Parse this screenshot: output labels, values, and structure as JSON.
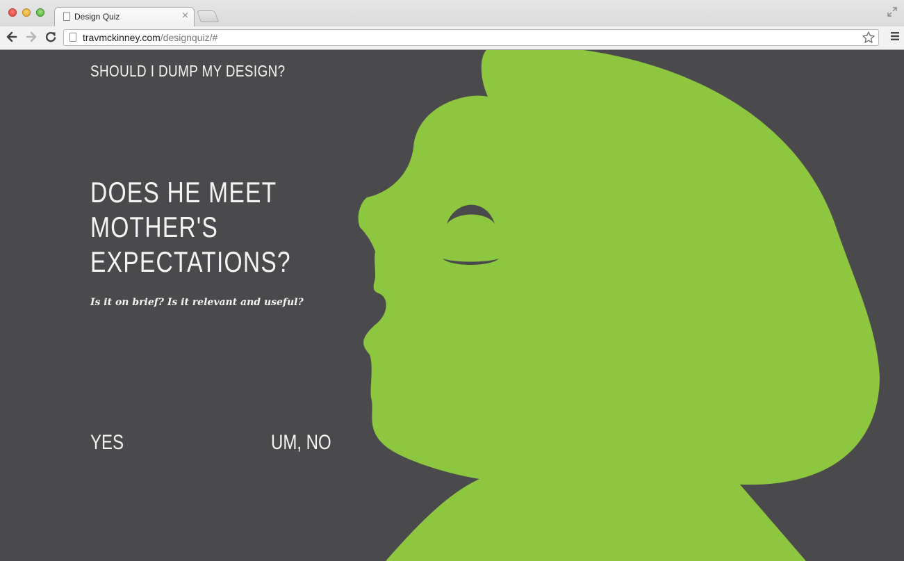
{
  "browser": {
    "tab_title": "Design Quiz",
    "tab_close": "×",
    "url_domain": "travmckinney.com",
    "url_path": "/designquiz/#"
  },
  "page": {
    "site_title": "SHOULD I DUMP MY DESIGN?",
    "question_lines": [
      "DOES HE MEET",
      "MOTHER'S",
      "EXPECTATIONS?"
    ],
    "subtext": "Is it on brief? Is it relevant and useful?",
    "answers": {
      "yes": "YES",
      "no": "UM, NO"
    }
  },
  "colors": {
    "background": "#4a4a4c",
    "silhouette": "#8dc63f",
    "text": "#f4f4f4"
  }
}
